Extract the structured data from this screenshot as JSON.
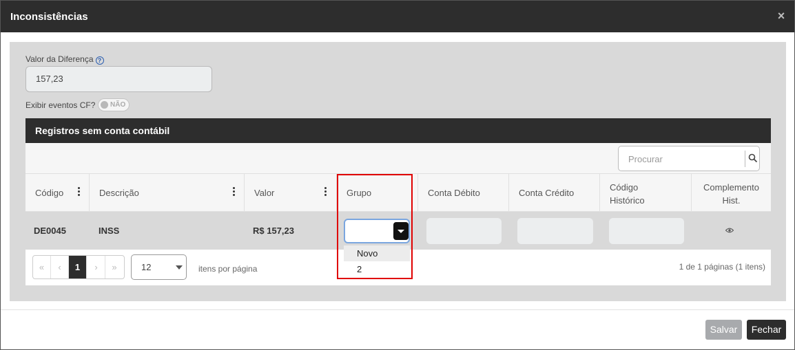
{
  "modal": {
    "title": "Inconsistências",
    "close_glyph": "×"
  },
  "form": {
    "diff_label": "Valor da Diferença",
    "diff_value": "157,23",
    "cf_label": "Exibir eventos CF?",
    "cf_toggle": "NÃO"
  },
  "grid": {
    "title": "Registros sem conta contábil",
    "search_placeholder": "Procurar",
    "columns": {
      "codigo": "Código",
      "descricao": "Descrição",
      "valor": "Valor",
      "grupo": "Grupo",
      "conta_debito": "Conta Débito",
      "conta_credito": "Conta Crédito",
      "codigo_historico_1": "Código",
      "codigo_historico_2": "Histórico",
      "complemento_1": "Complemento",
      "complemento_2": "Hist."
    },
    "row": {
      "codigo": "DE0045",
      "descricao": "INSS",
      "valor": "R$ 157,23"
    },
    "grupo_options": [
      "Novo",
      "2"
    ],
    "pager": {
      "first": "«",
      "prev": "‹",
      "current": "1",
      "next": "›",
      "last": "»",
      "page_size": "12",
      "per_page_label": "itens por página",
      "info": "1 de 1 páginas (1 itens)"
    }
  },
  "footer": {
    "save": "Salvar",
    "close": "Fechar"
  },
  "colors": {
    "header_bg": "#2d2d2d",
    "highlight": "#e00000",
    "select_border": "#7aa6df"
  }
}
